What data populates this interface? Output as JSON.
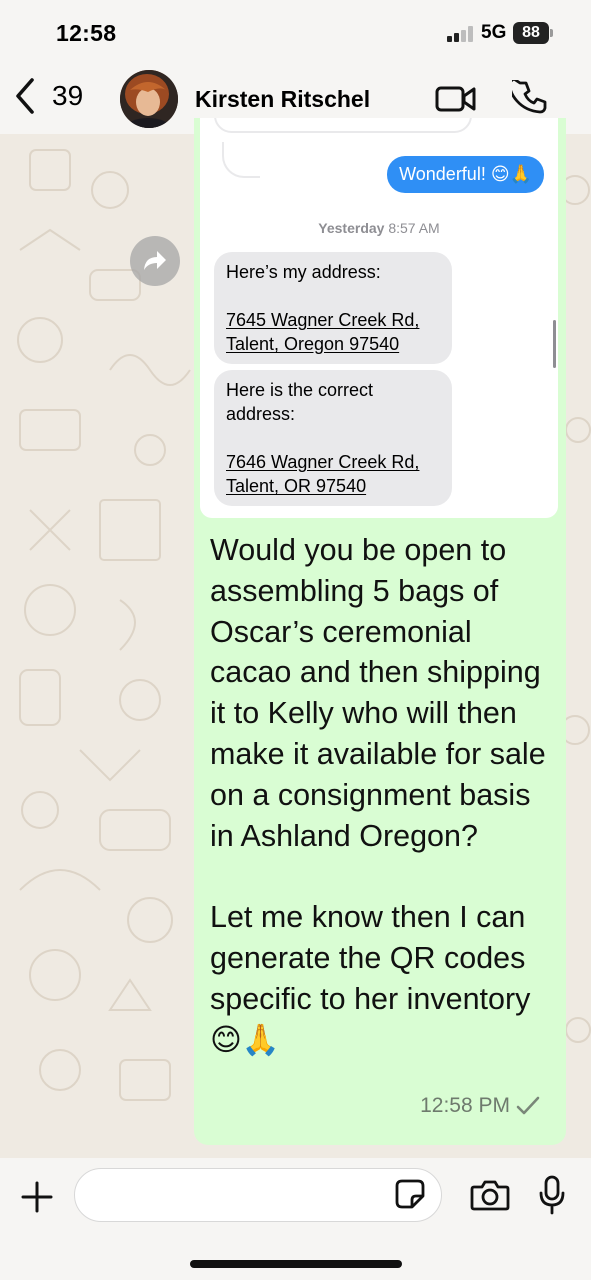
{
  "status_bar": {
    "time": "12:58",
    "network": "5G",
    "battery": "88"
  },
  "header": {
    "back_count": "39",
    "contact_name": "Kirsten Ritschel"
  },
  "forwarded_screenshot": {
    "outgoing_message": "Wonderful! 😊🙏",
    "timestamp_day": "Yesterday",
    "timestamp_time": "8:57 AM",
    "message_1_intro": "Here’s my address:",
    "message_1_line1": "7645 Wagner Creek Rd,",
    "message_1_line2": "Talent, Oregon 97540",
    "message_2_intro": "Here is the correct address:",
    "message_2_line1": "7646 Wagner Creek Rd,",
    "message_2_line2": "Talent, OR 97540"
  },
  "message": {
    "text": "Would you be open to assembling 5 bags of Oscar’s ceremonial cacao and then shipping it to Kelly who will then make it available for sale on a consignment basis in Ashland Oregon?\n\nLet me know then I can generate the QR codes specific to her inventory 😊🙏",
    "time": "12:58 PM",
    "status": "sent"
  },
  "input": {
    "placeholder": ""
  },
  "colors": {
    "outgoing_bubble": "#d9fdd3",
    "imessage_blue": "#2f8ff5",
    "wallpaper": "#efeae2"
  },
  "icons": [
    "back-chevron-icon",
    "video-call-icon",
    "phone-icon",
    "forward-icon",
    "checkmark-icon",
    "plus-icon",
    "sticker-icon",
    "camera-icon",
    "microphone-icon"
  ]
}
